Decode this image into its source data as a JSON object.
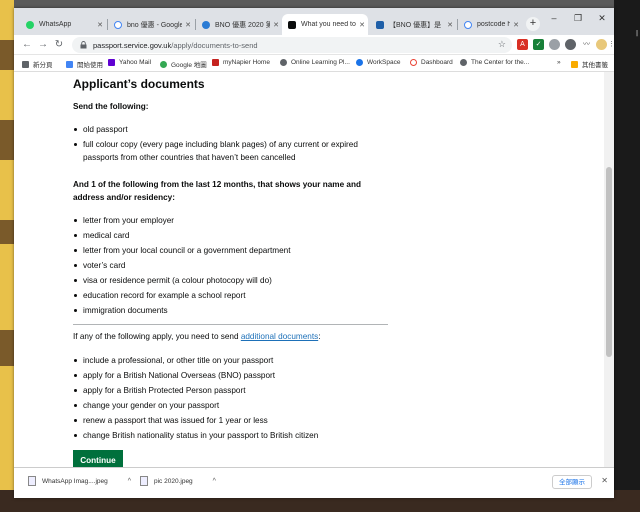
{
  "colors": {
    "continue_green": "#00703c",
    "link_blue": "#1d70b8",
    "tab_strip": "#dee1e6"
  },
  "browser": {
    "tabs": [
      {
        "label": "WhatsApp",
        "icon": "whatsapp-icon",
        "active": false
      },
      {
        "label": "bno 優惠 - Google",
        "icon": "google-icon",
        "active": false
      },
      {
        "label": "BNO 優惠 2020 第",
        "icon": "site-icon",
        "active": false
      },
      {
        "label": "What you need to",
        "icon": "govuk-icon",
        "active": true
      },
      {
        "label": "【BNO 優惠】是",
        "icon": "site-icon",
        "active": false
      },
      {
        "label": "postcode hk - Go",
        "icon": "google-icon",
        "active": false
      }
    ],
    "new_tab": "+",
    "url_host": "passport.service.gov.uk",
    "url_path": "/apply/documents-to-send",
    "bookmarks": [
      "新分頁",
      "開始使用",
      "Yahoo Mail",
      "Google 地圖",
      "myNapier Home",
      "Online Learning Pl...",
      "WorkSpace",
      "Dashboard",
      "The Center for the..."
    ],
    "bookmarks_more": "»",
    "other_bookmarks": "其他書籤"
  },
  "page": {
    "title": "Applicant’s documents",
    "send_heading": "Send the following:",
    "send_items": [
      "old passport",
      "full colour copy (every page including blank pages) of any current or expired passports from other countries that haven’t been cancelled"
    ],
    "proof_heading": "And 1 of the following from the last 12 months, that shows your name and address and/or residency:",
    "proof_items": [
      "letter from your employer",
      "medical card",
      "letter from your local council or a government department",
      "voter’s card",
      "visa or residence permit (a colour photocopy will do)",
      "education record for example a school report",
      "immigration documents"
    ],
    "additional_prefix": "If any of the following apply, you need to send ",
    "additional_link": "additional documents",
    "additional_suffix": ":",
    "additional_items": [
      "include a professional, or other title on your passport",
      "apply for a British National Overseas (BNO) passport",
      "apply for a British Protected Person passport",
      "change your gender on your passport",
      "renew a passport that was issued for 1 year or less",
      "change British nationality status in your passport to British citizen"
    ],
    "continue_label": "Continue"
  },
  "downloads": {
    "items": [
      {
        "name": "WhatsApp Imag....jpeg"
      },
      {
        "name": "pic 2020.jpeg"
      }
    ],
    "show_all": "全部顯示"
  }
}
